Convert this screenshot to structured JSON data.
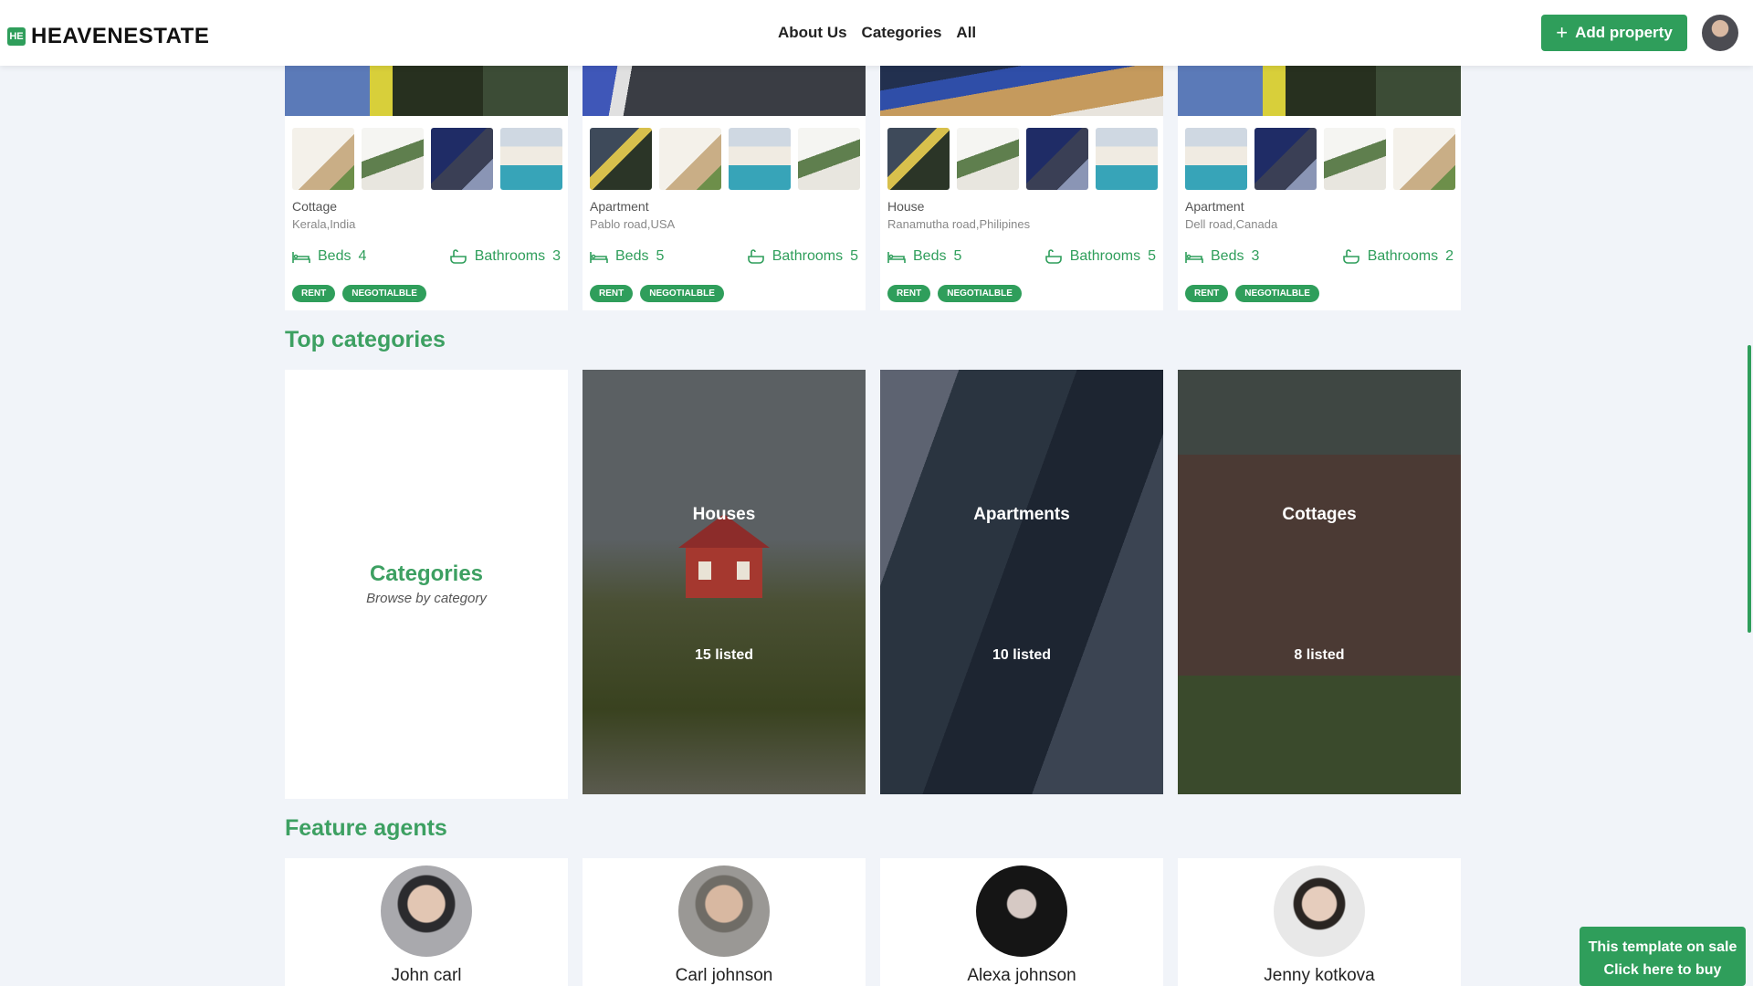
{
  "header": {
    "logo_mark": "HE",
    "logo_text": "HEAVENESTATE",
    "nav": [
      "About Us",
      "Categories",
      "All"
    ],
    "add_property_label": "Add property",
    "accent_color": "#2f9e5b"
  },
  "properties": [
    {
      "type": "Cottage",
      "location": "Kerala,India",
      "beds_label": "Beds",
      "beds": "4",
      "baths_label": "Bathrooms",
      "baths": "3",
      "tags": [
        "RENT",
        "NEGOTIALBLE"
      ]
    },
    {
      "type": "Apartment",
      "location": "Pablo road,USA",
      "beds_label": "Beds",
      "beds": "5",
      "baths_label": "Bathrooms",
      "baths": "5",
      "tags": [
        "RENT",
        "NEGOTIALBLE"
      ]
    },
    {
      "type": "House",
      "location": "Ranamutha road,Philipines",
      "beds_label": "Beds",
      "beds": "5",
      "baths_label": "Bathrooms",
      "baths": "5",
      "tags": [
        "RENT",
        "NEGOTIALBLE"
      ]
    },
    {
      "type": "Apartment",
      "location": "Dell road,Canada",
      "beds_label": "Beds",
      "beds": "3",
      "baths_label": "Bathrooms",
      "baths": "2",
      "tags": [
        "RENT",
        "NEGOTIALBLE"
      ]
    }
  ],
  "top_categories": {
    "title": "Top categories",
    "intro_title": "Categories",
    "intro_subtitle": "Browse by category",
    "items": [
      {
        "name": "Houses",
        "count": "15 listed"
      },
      {
        "name": "Apartments",
        "count": "10 listed"
      },
      {
        "name": "Cottages",
        "count": "8 listed"
      }
    ]
  },
  "agents": {
    "title": "Feature agents",
    "items": [
      {
        "name": "John carl"
      },
      {
        "name": "Carl johnson"
      },
      {
        "name": "Alexa johnson"
      },
      {
        "name": "Jenny kotkova"
      }
    ]
  },
  "promo": {
    "line1": "This template on sale",
    "line2": "Click here to buy"
  }
}
